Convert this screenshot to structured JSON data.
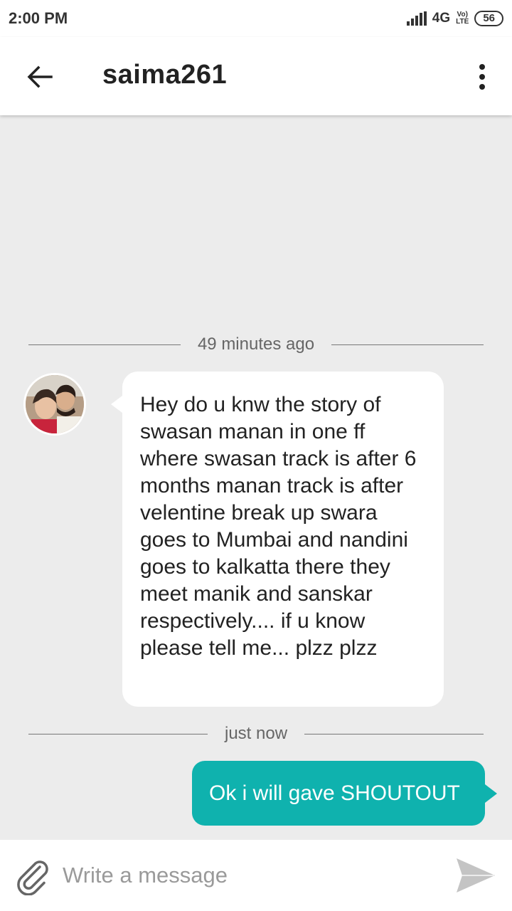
{
  "status_bar": {
    "time": "2:00 PM",
    "network": "4G",
    "volte": "Vo) LTE",
    "battery": "56"
  },
  "app_bar": {
    "back_icon": "arrow-left-icon",
    "title": "saima261",
    "more_icon": "more-vertical-icon"
  },
  "chat": {
    "divider_1": "49 minutes ago",
    "incoming_message": "Hey do u knw the story of swasan manan in one ff where swasan track is after 6 months manan track is after velentine break up swara goes to Mumbai and nandini goes to kalkatta there they meet manik and sanskar respectively.... if u know please tell me... plzz plzz",
    "divider_2": "just now",
    "outgoing_message": "Ok i will gave SHOUTOUT"
  },
  "composer": {
    "placeholder": "Write a message",
    "value": "",
    "attach_icon": "paperclip-icon",
    "send_icon": "send-icon"
  },
  "colors": {
    "accent": "#0fb2ae",
    "background": "#ececec",
    "bubble_incoming": "#ffffff"
  }
}
